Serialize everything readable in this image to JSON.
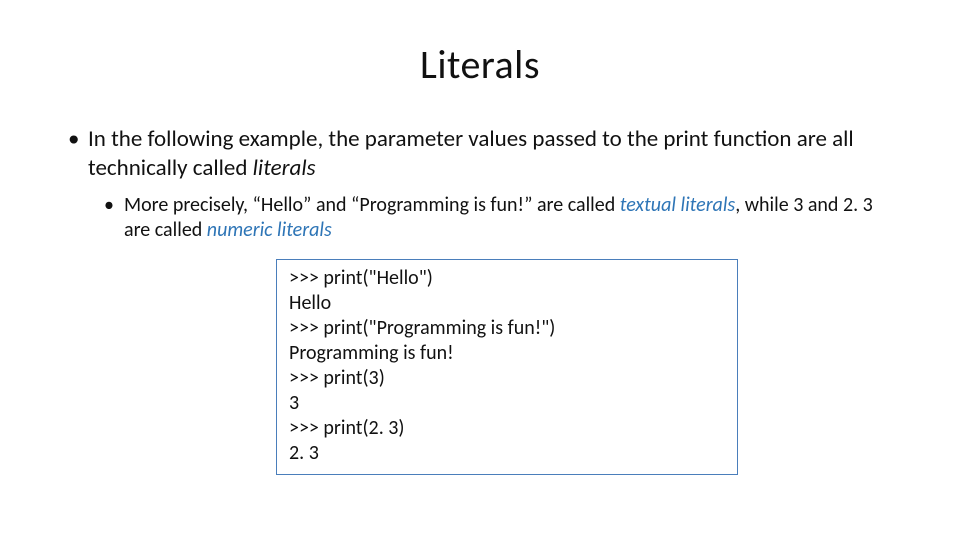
{
  "title": "Literals",
  "bullet1": {
    "pre": "In the following example, the parameter values passed to the print function are all technically called ",
    "italic": "literals"
  },
  "bullet2": {
    "part1": "More precisely, “Hello” and “Programming is fun!” are called ",
    "accent1": "textual literals",
    "part2": ", while 3 and 2. 3 are called ",
    "accent2": "numeric literals"
  },
  "code": {
    "l1": ">>> print(\"Hello\")",
    "l2": "Hello",
    "l3": ">>> print(\"Programming is fun!\")",
    "l4": "Programming is fun!",
    "l5": ">>> print(3)",
    "l6": "3",
    "l7": ">>> print(2. 3)",
    "l8": "2. 3"
  }
}
